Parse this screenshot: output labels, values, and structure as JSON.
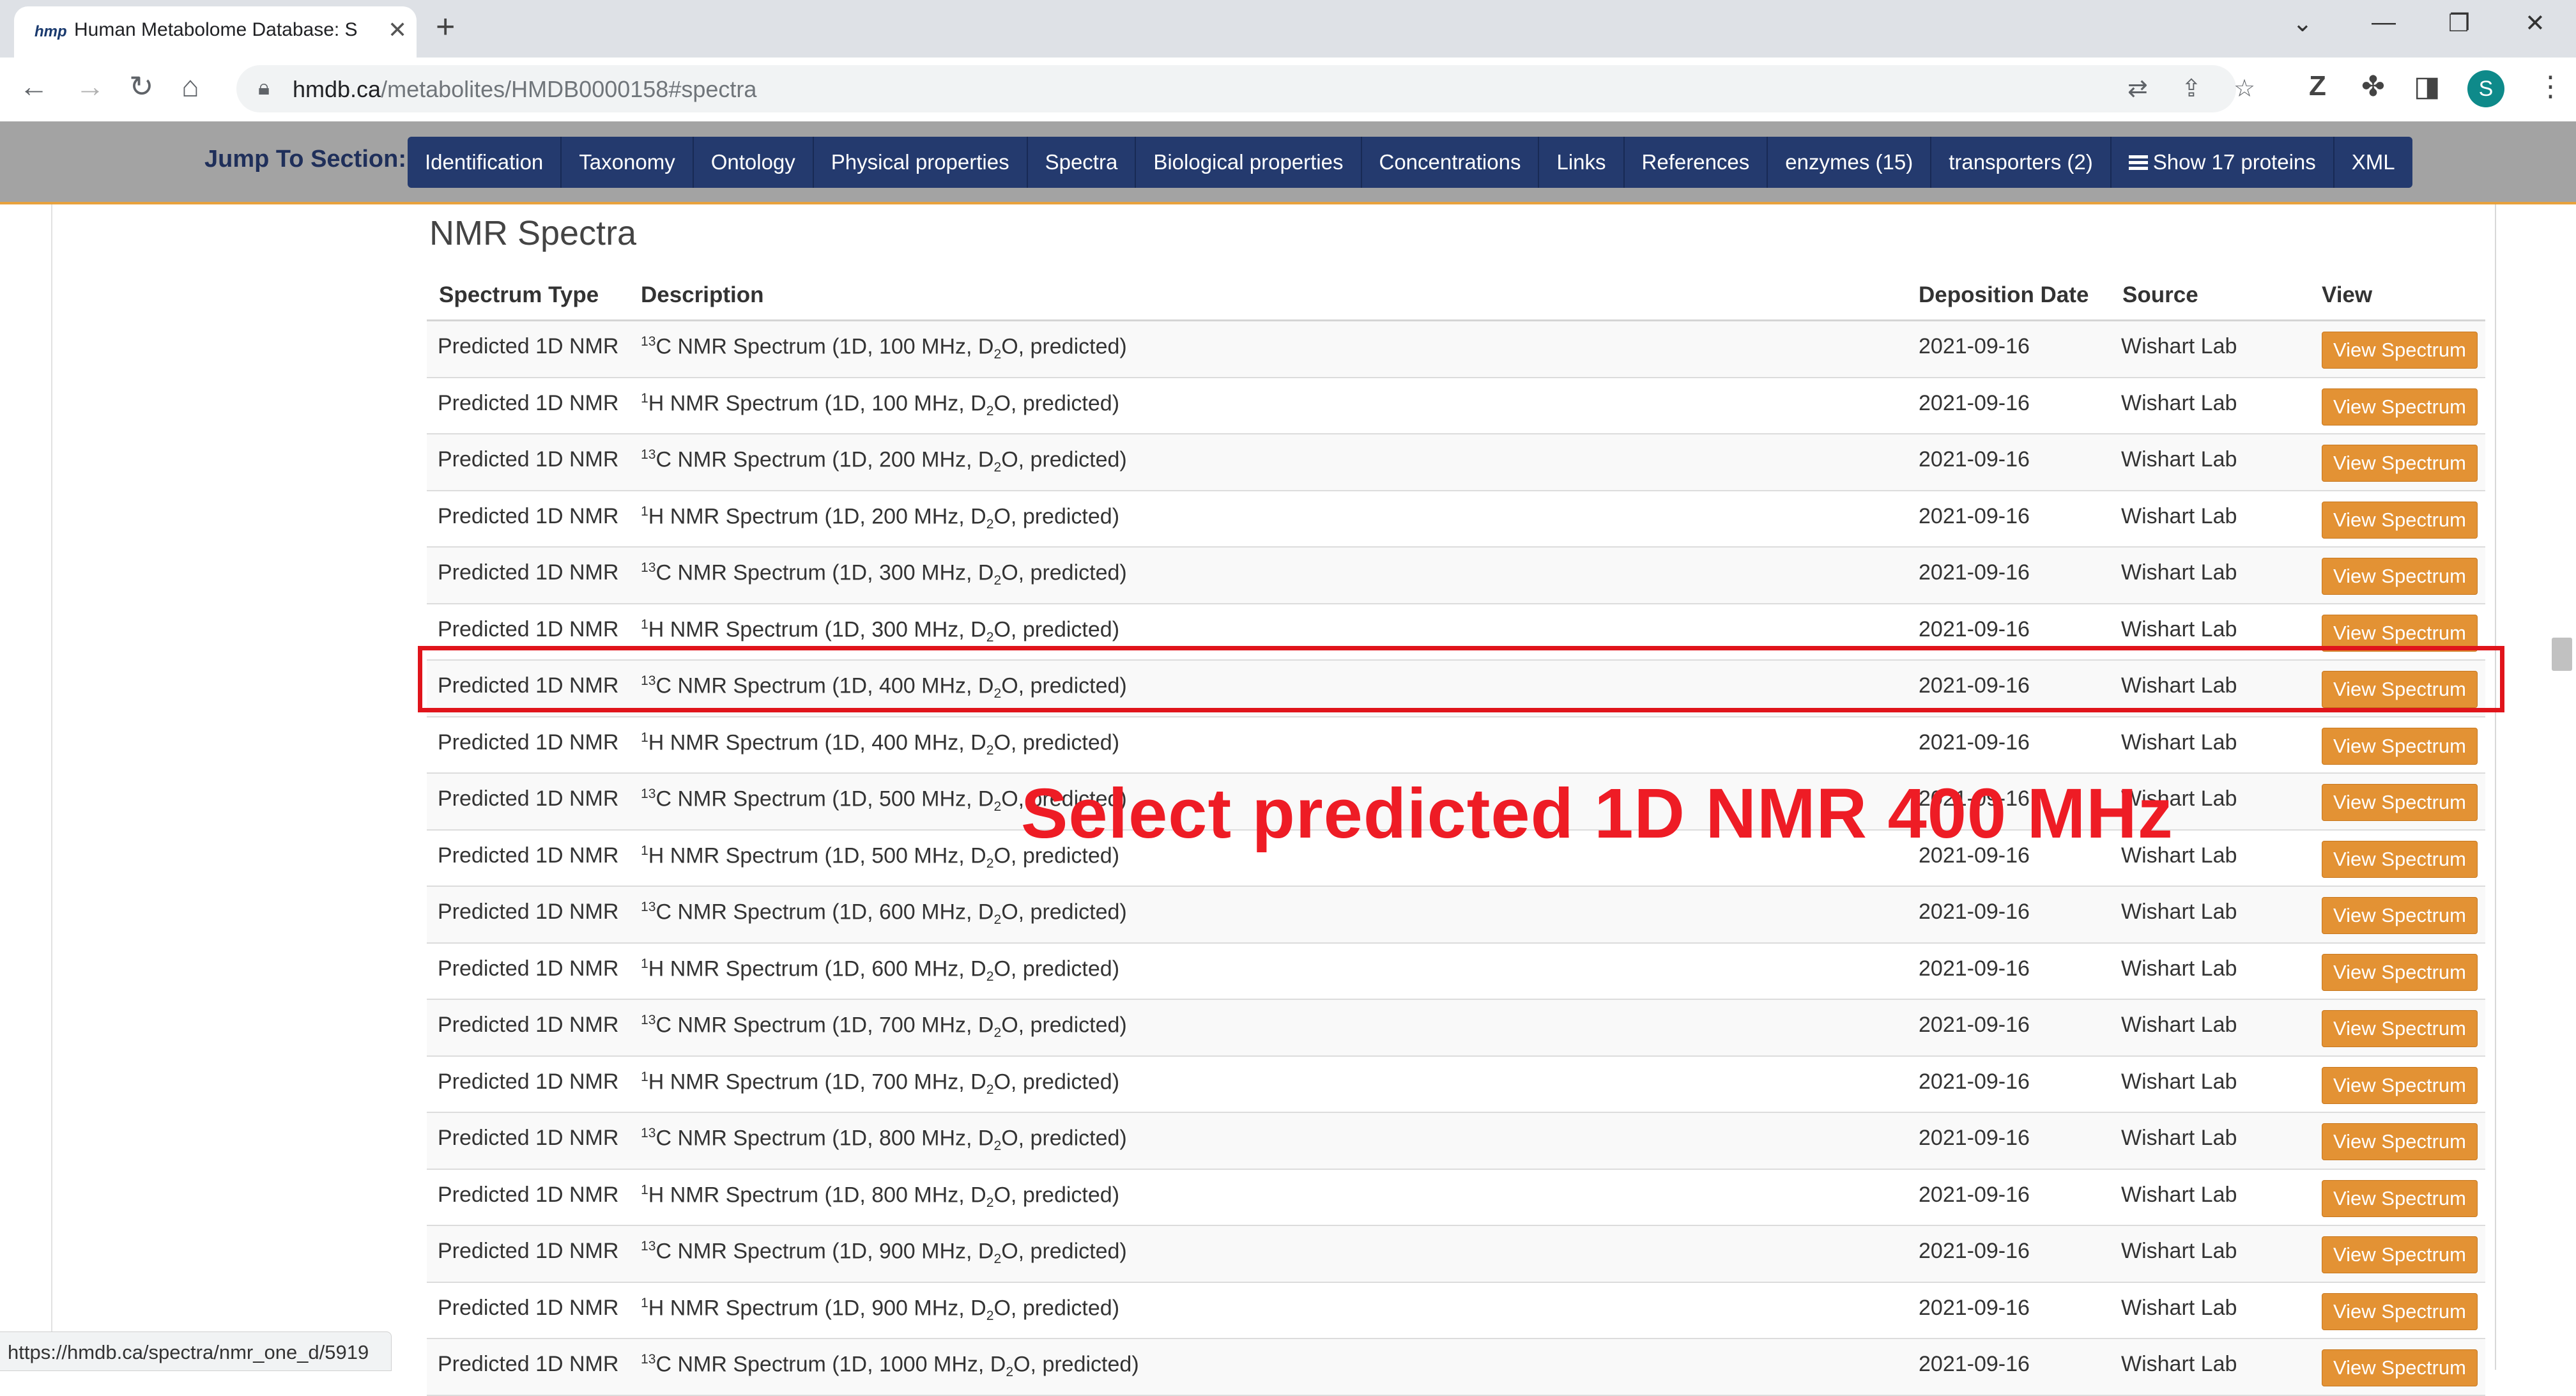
{
  "browser": {
    "tab_favicon": "hmp",
    "tab_title": "Human Metabolome Database: S",
    "url_host": "hmdb.ca",
    "url_path": "/metabolites/HMDB0000158#spectra",
    "avatar_letter": "S",
    "status_url": "https://hmdb.ca/spectra/nmr_one_d/5919"
  },
  "jump": {
    "label": "Jump To Section:",
    "items": [
      "Identification",
      "Taxonomy",
      "Ontology",
      "Physical properties",
      "Spectra",
      "Biological properties",
      "Concentrations",
      "Links",
      "References",
      "enzymes (15)",
      "transporters (2)",
      "Show 17 proteins",
      "XML"
    ]
  },
  "section": {
    "title": "NMR Spectra",
    "headers": {
      "type": "Spectrum Type",
      "description": "Description",
      "date": "Deposition Date",
      "source": "Source",
      "view": "View"
    },
    "rows": [
      {
        "type": "Predicted 1D NMR",
        "nucleus_mass": "13",
        "nucleus": "C",
        "desc_a": " NMR Spectrum (1D, 100 MHz, D",
        "desc_sub": "2",
        "desc_b": "O, predicted)",
        "date": "2021-09-16",
        "source": "Wishart Lab",
        "button": "View Spectrum"
      },
      {
        "type": "Predicted 1D NMR",
        "nucleus_mass": "1",
        "nucleus": "H",
        "desc_a": " NMR Spectrum (1D, 100 MHz, D",
        "desc_sub": "2",
        "desc_b": "O, predicted)",
        "date": "2021-09-16",
        "source": "Wishart Lab",
        "button": "View Spectrum"
      },
      {
        "type": "Predicted 1D NMR",
        "nucleus_mass": "13",
        "nucleus": "C",
        "desc_a": " NMR Spectrum (1D, 200 MHz, D",
        "desc_sub": "2",
        "desc_b": "O, predicted)",
        "date": "2021-09-16",
        "source": "Wishart Lab",
        "button": "View Spectrum"
      },
      {
        "type": "Predicted 1D NMR",
        "nucleus_mass": "1",
        "nucleus": "H",
        "desc_a": " NMR Spectrum (1D, 200 MHz, D",
        "desc_sub": "2",
        "desc_b": "O, predicted)",
        "date": "2021-09-16",
        "source": "Wishart Lab",
        "button": "View Spectrum"
      },
      {
        "type": "Predicted 1D NMR",
        "nucleus_mass": "13",
        "nucleus": "C",
        "desc_a": " NMR Spectrum (1D, 300 MHz, D",
        "desc_sub": "2",
        "desc_b": "O, predicted)",
        "date": "2021-09-16",
        "source": "Wishart Lab",
        "button": "View Spectrum"
      },
      {
        "type": "Predicted 1D NMR",
        "nucleus_mass": "1",
        "nucleus": "H",
        "desc_a": " NMR Spectrum (1D, 300 MHz, D",
        "desc_sub": "2",
        "desc_b": "O, predicted)",
        "date": "2021-09-16",
        "source": "Wishart Lab",
        "button": "View Spectrum"
      },
      {
        "type": "Predicted 1D NMR",
        "nucleus_mass": "13",
        "nucleus": "C",
        "desc_a": " NMR Spectrum (1D, 400 MHz, D",
        "desc_sub": "2",
        "desc_b": "O, predicted)",
        "date": "2021-09-16",
        "source": "Wishart Lab",
        "button": "View Spectrum"
      },
      {
        "type": "Predicted 1D NMR",
        "nucleus_mass": "1",
        "nucleus": "H",
        "desc_a": " NMR Spectrum (1D, 400 MHz, D",
        "desc_sub": "2",
        "desc_b": "O, predicted)",
        "date": "2021-09-16",
        "source": "Wishart Lab",
        "button": "View Spectrum"
      },
      {
        "type": "Predicted 1D NMR",
        "nucleus_mass": "13",
        "nucleus": "C",
        "desc_a": " NMR Spectrum (1D, 500 MHz, D",
        "desc_sub": "2",
        "desc_b": "O, predicted)",
        "date": "2021-09-16",
        "source": "Wishart Lab",
        "button": "View Spectrum"
      },
      {
        "type": "Predicted 1D NMR",
        "nucleus_mass": "1",
        "nucleus": "H",
        "desc_a": " NMR Spectrum (1D, 500 MHz, D",
        "desc_sub": "2",
        "desc_b": "O, predicted)",
        "date": "2021-09-16",
        "source": "Wishart Lab",
        "button": "View Spectrum"
      },
      {
        "type": "Predicted 1D NMR",
        "nucleus_mass": "13",
        "nucleus": "C",
        "desc_a": " NMR Spectrum (1D, 600 MHz, D",
        "desc_sub": "2",
        "desc_b": "O, predicted)",
        "date": "2021-09-16",
        "source": "Wishart Lab",
        "button": "View Spectrum"
      },
      {
        "type": "Predicted 1D NMR",
        "nucleus_mass": "1",
        "nucleus": "H",
        "desc_a": " NMR Spectrum (1D, 600 MHz, D",
        "desc_sub": "2",
        "desc_b": "O, predicted)",
        "date": "2021-09-16",
        "source": "Wishart Lab",
        "button": "View Spectrum"
      },
      {
        "type": "Predicted 1D NMR",
        "nucleus_mass": "13",
        "nucleus": "C",
        "desc_a": " NMR Spectrum (1D, 700 MHz, D",
        "desc_sub": "2",
        "desc_b": "O, predicted)",
        "date": "2021-09-16",
        "source": "Wishart Lab",
        "button": "View Spectrum"
      },
      {
        "type": "Predicted 1D NMR",
        "nucleus_mass": "1",
        "nucleus": "H",
        "desc_a": " NMR Spectrum (1D, 700 MHz, D",
        "desc_sub": "2",
        "desc_b": "O, predicted)",
        "date": "2021-09-16",
        "source": "Wishart Lab",
        "button": "View Spectrum"
      },
      {
        "type": "Predicted 1D NMR",
        "nucleus_mass": "13",
        "nucleus": "C",
        "desc_a": " NMR Spectrum (1D, 800 MHz, D",
        "desc_sub": "2",
        "desc_b": "O, predicted)",
        "date": "2021-09-16",
        "source": "Wishart Lab",
        "button": "View Spectrum"
      },
      {
        "type": "Predicted 1D NMR",
        "nucleus_mass": "1",
        "nucleus": "H",
        "desc_a": " NMR Spectrum (1D, 800 MHz, D",
        "desc_sub": "2",
        "desc_b": "O, predicted)",
        "date": "2021-09-16",
        "source": "Wishart Lab",
        "button": "View Spectrum"
      },
      {
        "type": "Predicted 1D NMR",
        "nucleus_mass": "13",
        "nucleus": "C",
        "desc_a": " NMR Spectrum (1D, 900 MHz, D",
        "desc_sub": "2",
        "desc_b": "O, predicted)",
        "date": "2021-09-16",
        "source": "Wishart Lab",
        "button": "View Spectrum"
      },
      {
        "type": "Predicted 1D NMR",
        "nucleus_mass": "1",
        "nucleus": "H",
        "desc_a": " NMR Spectrum (1D, 900 MHz, D",
        "desc_sub": "2",
        "desc_b": "O, predicted)",
        "date": "2021-09-16",
        "source": "Wishart Lab",
        "button": "View Spectrum"
      },
      {
        "type": "Predicted 1D NMR",
        "nucleus_mass": "13",
        "nucleus": "C",
        "desc_a": " NMR Spectrum (1D, 1000 MHz, D",
        "desc_sub": "2",
        "desc_b": "O, predicted)",
        "date": "2021-09-16",
        "source": "Wishart Lab",
        "button": "View Spectrum"
      }
    ]
  },
  "annotation": {
    "text": "Select  predicted 1D NMR 400 MHz",
    "color": "#ee1c25"
  },
  "colors": {
    "nav_bg": "#243a6e",
    "view_button": "#e39234",
    "jump_bar_border": "#e8a13c",
    "highlight_box": "#e0141b"
  },
  "icons": {
    "back": "back-arrow-icon",
    "forward": "forward-arrow-icon",
    "reload": "reload-icon",
    "home": "home-icon",
    "lock": "lock-icon",
    "translate": "translate-icon",
    "share": "share-icon",
    "bookmark": "star-icon",
    "extension_z": "z-extension-icon",
    "extensions": "puzzle-icon",
    "sidepanel": "side-panel-icon",
    "menu": "kebab-menu-icon",
    "list": "list-icon"
  }
}
